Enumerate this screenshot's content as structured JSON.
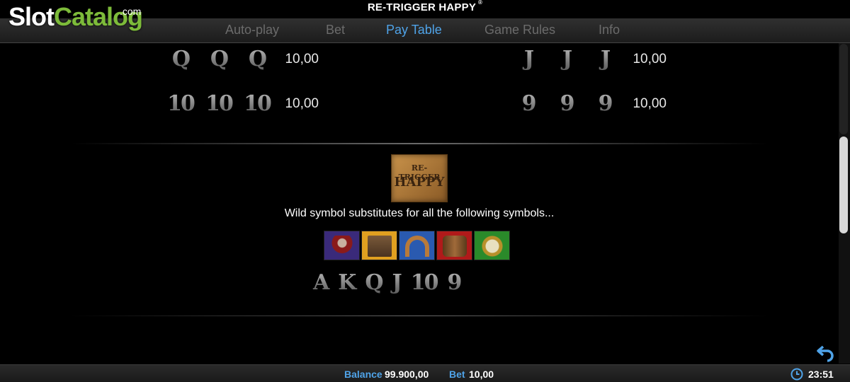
{
  "header": {
    "game_title": "RE-TRIGGER HAPPY",
    "registered_mark": "®",
    "logo": {
      "slot": "Slot",
      "catalog": "Catalog",
      "dotcom": ".com"
    }
  },
  "tabs": [
    {
      "label": "Auto-play",
      "active": false
    },
    {
      "label": "Bet",
      "active": false
    },
    {
      "label": "Pay Table",
      "active": true
    },
    {
      "label": "Game Rules",
      "active": false
    },
    {
      "label": "Info",
      "active": false
    }
  ],
  "paytable": [
    {
      "symbol": "Q",
      "value": "10,00"
    },
    {
      "symbol": "J",
      "value": "10,00"
    },
    {
      "symbol": "10",
      "value": "10,00"
    },
    {
      "symbol": "9",
      "value": "10,00"
    }
  ],
  "wild": {
    "logo_line1": "RE-TRIGGER",
    "logo_line2": "HAPPY",
    "description": "Wild symbol substitutes for all the following symbols...",
    "icons": [
      "bandit-icon",
      "saloon-icon",
      "horseshoe-icon",
      "barrel-icon",
      "pocket-watch-icon"
    ],
    "cards": [
      "A",
      "K",
      "Q",
      "J",
      "10",
      "9"
    ]
  },
  "footer": {
    "balance_label": "Balance",
    "balance_value": "99.900,00",
    "bet_label": "Bet",
    "bet_value": "10,00",
    "time": "23:51"
  },
  "colors": {
    "accent": "#4fa3e8",
    "logo_green": "#7dbb3a",
    "inactive_tab": "#6b6b6b",
    "scroll_thumb": "#d8d8d8"
  }
}
